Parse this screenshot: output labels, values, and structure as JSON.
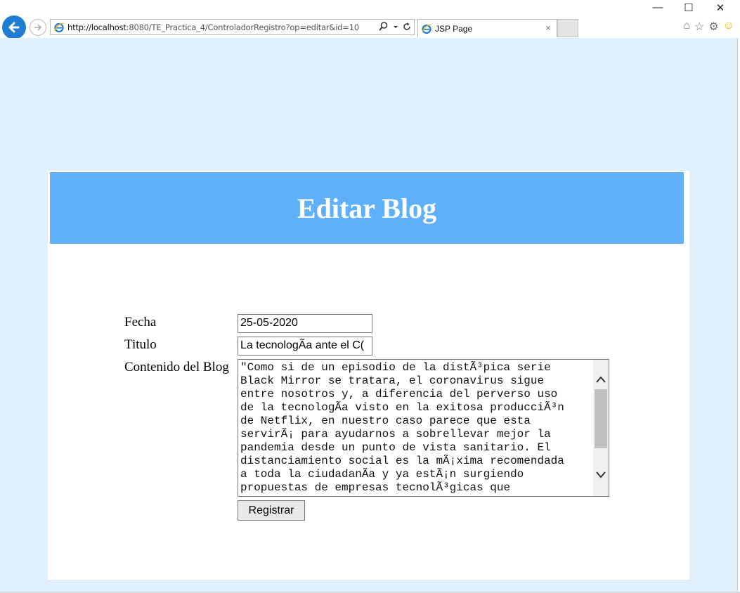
{
  "browser": {
    "url_host": "http://localhost",
    "url_rest": ":8080/TE_Practica_4/ControladorRegistro?op=editar&id=10",
    "tab_title": "JSP Page",
    "tab_close": "×",
    "search_icon": "search-icon",
    "refresh_icon": "refresh-icon",
    "minimize": "—",
    "maximize": "☐",
    "close": "✕"
  },
  "page": {
    "heading": "Editar Blog",
    "form": {
      "fecha_label": "Fecha",
      "fecha_value": "25-05-2020",
      "titulo_label": "Titulo",
      "titulo_value": "La tecnologÃa ante el C(",
      "contenido_label": "Contenido del Blog",
      "contenido_value": "\"Como si de un episodio de la distÃ³pica serie\nBlack Mirror se tratara, el coronavirus sigue\nentre nosotros y, a diferencia del perverso uso\nde la tecnologÃa visto en la exitosa producciÃ³n\nde Netflix, en nuestro caso parece que esta\nservirÃ¡ para ayudarnos a sobrellevar mejor la\npandemia desde un punto de vista sanitario. El\ndistanciamiento social es la mÃ¡xima recomendada\na toda la ciudadanÃa y ya estÃ¡n surgiendo\npropuestas de empresas tecnolÃ³gicas que",
      "submit_label": "Registrar"
    }
  },
  "colors": {
    "page_bg": "#e0effc",
    "banner_bg": "#5fb0fb",
    "banner_text": "#ffffff"
  }
}
